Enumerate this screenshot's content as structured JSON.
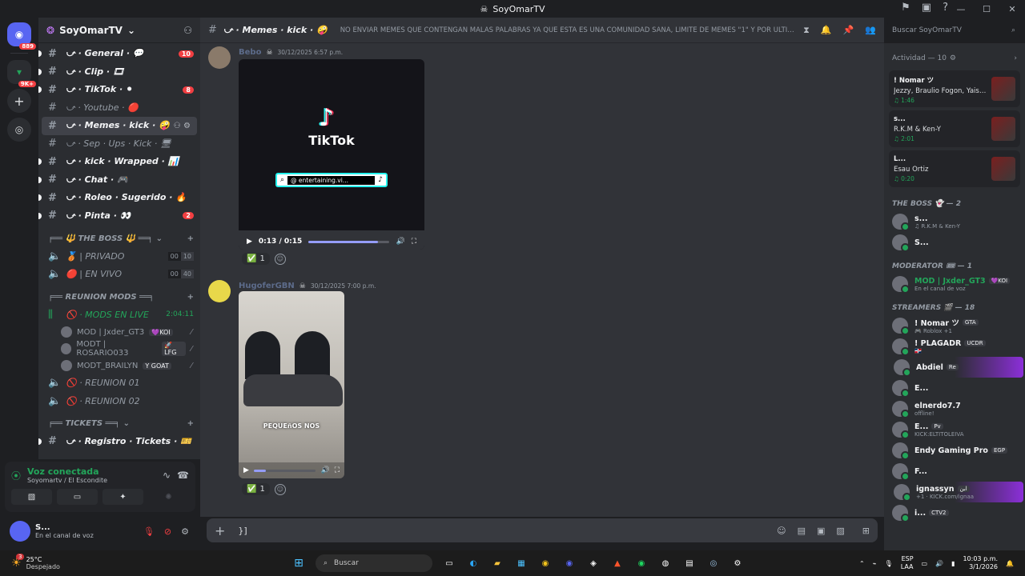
{
  "window": {
    "title": "SoyOmarTV"
  },
  "servers": {
    "home_badge": "889",
    "second_badge": "9K+"
  },
  "guild": {
    "name": "SoyOmarTV"
  },
  "channels": [
    {
      "name": "⤻ · General · 💬",
      "mention": "10",
      "unread": true
    },
    {
      "name": "⤻ · Clip · 🎞",
      "mention": "",
      "unread": true
    },
    {
      "name": "⤻ · TikTok · ⚫",
      "mention": "8",
      "unread": true
    },
    {
      "name": "⤻ · Youtube · 🔴",
      "mention": "",
      "unread": false
    },
    {
      "name": "⤻ · Memes · kick · 🤪",
      "mention": "",
      "unread": true,
      "active": true
    },
    {
      "name": "⤻ · Sep · Ups · Kick · 🖥",
      "mention": "",
      "unread": false
    },
    {
      "name": "⤻ · kick · Wrapped · 📊",
      "mention": "",
      "unread": true
    },
    {
      "name": "⤻ · Chat · 🎮",
      "mention": "",
      "unread": true
    },
    {
      "name": "⤻ · Roleo · Sugerido · 🔥",
      "mention": "",
      "unread": true
    },
    {
      "name": "⤻ · Pinta · 👀",
      "mention": "2",
      "unread": true
    }
  ],
  "categories": {
    "boss": "╒══ 🔱 THE BOSS 🔱 ══╕",
    "reunion": "╒══ REUNION MODS ══╕",
    "tickets": "╒══ TICKETS ══╕"
  },
  "voice_channels": [
    {
      "name": "🥉 | PRIVADO",
      "c1": "00",
      "c2": "10"
    },
    {
      "name": "🔴 | EN VIVO",
      "c1": "00",
      "c2": "40"
    }
  ],
  "reunion": {
    "live": {
      "name": "🚫 · MODS EN LIVE",
      "timer": "2:04:11"
    },
    "users": [
      {
        "name": "MOD | Jxder_GT3",
        "tag": "💜KOI"
      },
      {
        "name": "MODT | ROSARIO033",
        "tag": "🚀LFG"
      },
      {
        "name": "MODT_BRAILYN",
        "tag": "Y GOAT"
      }
    ],
    "rooms": [
      "🚫 · REUNION 01",
      "🚫 · REUNION 02"
    ]
  },
  "tickets_channel": "⤻ · Registro · Tickets · 🎫",
  "voice_panel": {
    "status": "Voz conectada",
    "location": "Soyomartv / El Escondite"
  },
  "user_panel": {
    "name": "S...",
    "status": "En el canal de voz"
  },
  "chat_header": {
    "channel": "⤻ · Memes · kick · 🤪",
    "topic": "NO ENVIAR MEMES QUE CONTENGAN MALAS PALABRAS YA QUE ESTA ES UNA COMUNIDAD SANA, LIMITE DE MEMES \"1\" Y POR ULTIMO E...",
    "search_placeholder": "Buscar SoyOmarTV"
  },
  "messages": [
    {
      "user": "Bebo",
      "time": "30/12/2025 6:57 p.m.",
      "video_brand": "TikTok",
      "video_handle": "@ entertaining.vi...",
      "video_time": "0:13 / 0:15",
      "progress": 0.86,
      "reaction_emoji": "✅",
      "reaction_count": "1"
    },
    {
      "user": "HugoferGBN",
      "time": "30/12/2025 7:00 p.m.",
      "video_caption": "PEQUEñOS NOS",
      "progress": 0.2,
      "reaction_emoji": "✅",
      "reaction_count": "1"
    }
  ],
  "composer": {
    "text": "}]"
  },
  "members": {
    "activity_title": "Actividad — 10",
    "activities": [
      {
        "name": "! Nomar ツ",
        "song": "Jezzy, Braulio Fogon, Yaisel...",
        "time": "1:46"
      },
      {
        "name": "s...",
        "song": "R.K.M & Ken-Y",
        "time": "2:01"
      },
      {
        "name": "L...",
        "song": "Esau Ortiz",
        "time": "0:20"
      }
    ],
    "groups": [
      {
        "title": "THE BOSS 👻 — 2",
        "items": [
          {
            "name": "s...",
            "sub": "♫ R.K.M & Ken-Y",
            "tag": "",
            "color": "#f2f3f5"
          },
          {
            "name": "S...",
            "sub": "",
            "tag": "",
            "color": "#f2f3f5"
          }
        ]
      },
      {
        "title": "MODERATOR 🎟 — 1",
        "items": [
          {
            "name": "MOD | Jxder_GT3",
            "sub": "En el canal de voz",
            "tag": "💜KOI",
            "color": "#23a55a"
          }
        ]
      },
      {
        "title": "STREAMERS 🎬 — 18",
        "items": [
          {
            "name": "! Nomar ツ",
            "sub": "🎮 Roblox +1",
            "tag": "GTA",
            "color": "#f2f3f5"
          },
          {
            "name": "! PLAGADR",
            "sub": "🇩🇴",
            "tag": "UCDR",
            "color": "#f2f3f5"
          },
          {
            "name": "Abdiel",
            "sub": "",
            "tag": "Re",
            "color": "#f2f3f5",
            "highlight": true
          },
          {
            "name": "E...",
            "sub": "",
            "tag": "",
            "color": "#f2f3f5"
          },
          {
            "name": "elnerdo7.7",
            "sub": "offline!",
            "tag": "",
            "color": "#f2f3f5"
          },
          {
            "name": "E...",
            "sub": "KICK:ELTITOLEIVA",
            "tag": "Pv",
            "color": "#f2f3f5"
          },
          {
            "name": "Endy Gaming Pro",
            "sub": "",
            "tag": "EGP",
            "color": "#f2f3f5"
          },
          {
            "name": "F...",
            "sub": "",
            "tag": "",
            "color": "#f2f3f5"
          },
          {
            "name": "ignassyn",
            "sub": "+1 · KICK.com/ignaa",
            "tag": "ابن",
            "color": "#f2f3f5",
            "highlight": true
          },
          {
            "name": "i...",
            "sub": "",
            "tag": "CTV2",
            "color": "#f2f3f5"
          }
        ]
      }
    ]
  },
  "taskbar": {
    "weather_temp": "25°C",
    "weather_desc": "Despejado",
    "weather_badge": "3",
    "search": "Buscar",
    "lang1": "ESP",
    "lang2": "LAA",
    "time": "10:03 p.m.",
    "date": "3/1/2026"
  },
  "colors": {
    "accent": "#5865f2",
    "danger": "#f23f42",
    "online": "#23a55a"
  }
}
